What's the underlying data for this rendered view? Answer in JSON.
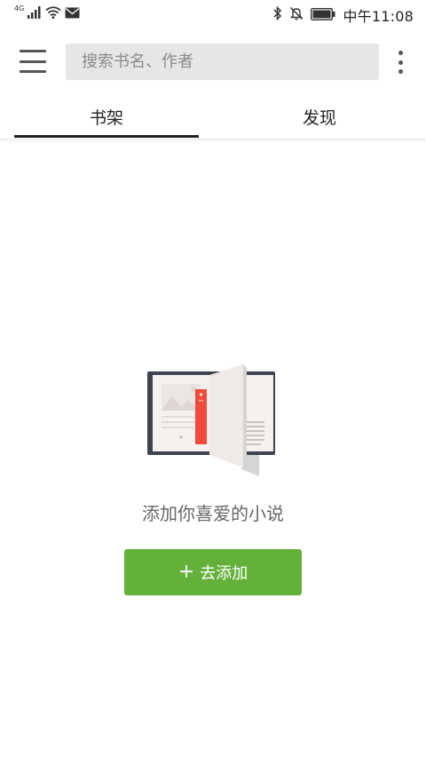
{
  "status_bar": {
    "network": "4G",
    "time": "中午11:08"
  },
  "toolbar": {
    "search_placeholder": "搜索书名、作者"
  },
  "tabs": [
    {
      "label": "书架",
      "active": true
    },
    {
      "label": "发现",
      "active": false
    }
  ],
  "empty_state": {
    "message": "添加你喜爱的小说",
    "button_label": "去添加",
    "button_icon": "plus-icon"
  },
  "colors": {
    "accent_green": "#63b13a",
    "bookmark_red": "#f04b3a",
    "book_cover": "#3d4350"
  }
}
